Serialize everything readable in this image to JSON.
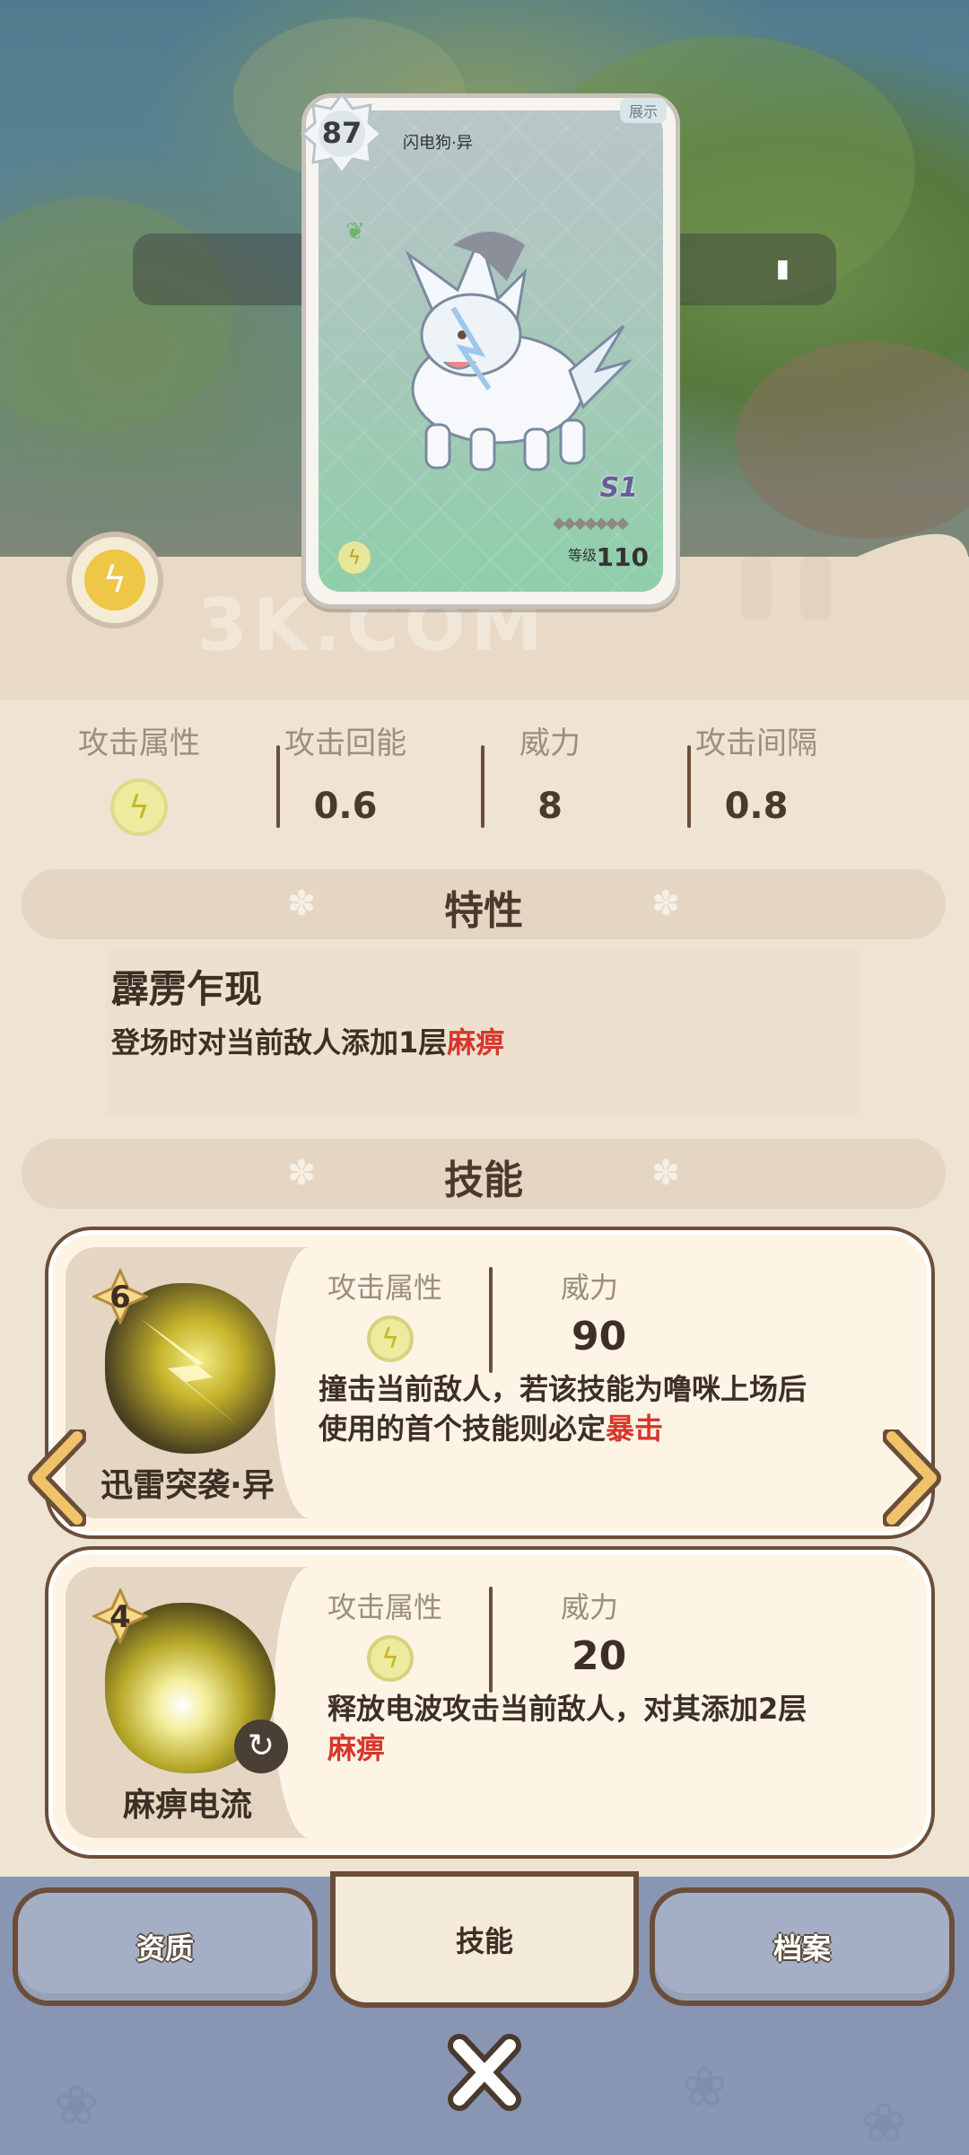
{
  "card": {
    "level_badge": "87",
    "name": "闪电狗·异",
    "tag": "展示",
    "series": "S1",
    "level_label": "等级",
    "level_value": "110"
  },
  "watermark": "3K.COM",
  "stats": [
    {
      "label": "攻击属性",
      "value": "",
      "icon": "lightning-icon"
    },
    {
      "label": "攻击回能",
      "value": "0.6"
    },
    {
      "label": "威力",
      "value": "8"
    },
    {
      "label": "攻击间隔",
      "value": "0.8"
    }
  ],
  "trait_section": {
    "title": "特性"
  },
  "trait": {
    "name": "霹雳乍现",
    "desc_prefix": "登场时对当前敌人添加1层",
    "desc_highlight": "麻痹"
  },
  "skill_section": {
    "title": "技能"
  },
  "skills": [
    {
      "cost": "6",
      "name": "迅雷突袭·异",
      "attr_label": "攻击属性",
      "power_label": "威力",
      "power": "90",
      "desc_line1": "撞击当前敌人，若该技能为噜咪上场后",
      "desc_line2_prefix": "使用的首个技能则必定",
      "desc_highlight": "暴击"
    },
    {
      "cost": "4",
      "name": "麻痹电流",
      "attr_label": "攻击属性",
      "power_label": "威力",
      "power": "20",
      "desc_line1": "释放电波攻击当前敌人，对其添加2层",
      "desc_highlight": "麻痹"
    }
  ],
  "tabs": [
    {
      "label": "资质",
      "active": false
    },
    {
      "label": "技能",
      "active": true
    },
    {
      "label": "档案",
      "active": false
    }
  ],
  "colors": {
    "accent_red": "#d8362c",
    "bg_cream": "#efe3d3",
    "brown_outline": "#6b4e3a",
    "tab_blue": "#8896b3"
  }
}
